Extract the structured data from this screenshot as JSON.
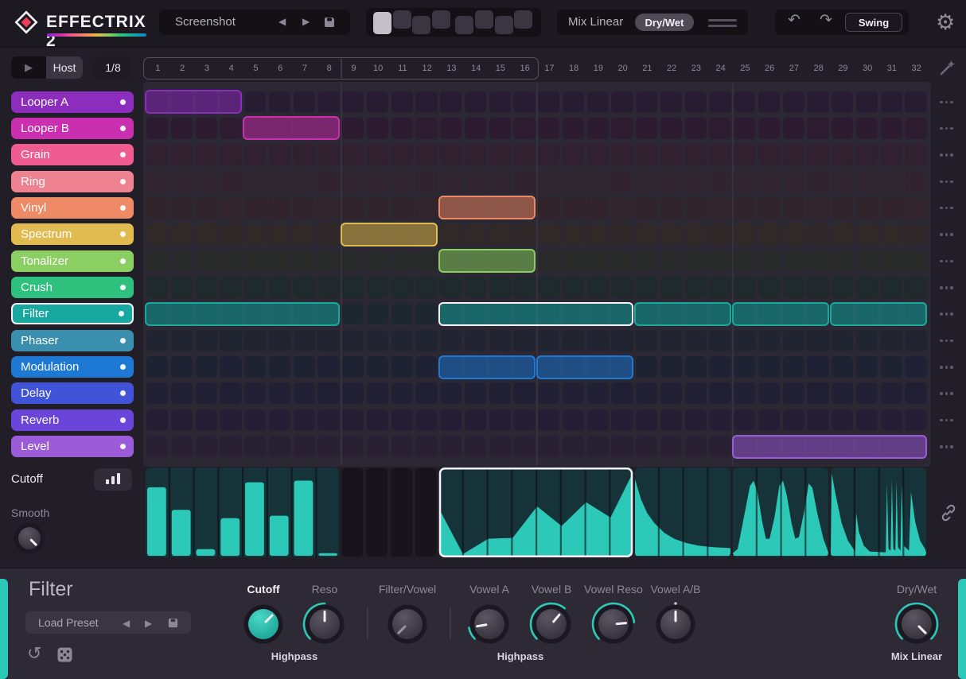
{
  "header": {
    "logo_text": "EFFECTRIX 2",
    "preset": {
      "name": "Screenshot"
    },
    "pattern_selector": {
      "count": 8,
      "selected": 1
    },
    "mix": {
      "label": "Mix Linear",
      "mode_button": "Dry/Wet"
    },
    "swing_button": "Swing"
  },
  "transport": {
    "host": "Host",
    "rate": "1/8"
  },
  "tracks": [
    {
      "name": "Looper A",
      "color": "#8c2dbd"
    },
    {
      "name": "Looper B",
      "color": "#c92fae"
    },
    {
      "name": "Grain",
      "color": "#f05c90"
    },
    {
      "name": "Ring",
      "color": "#ef8290"
    },
    {
      "name": "Vinyl",
      "color": "#ee8a66"
    },
    {
      "name": "Spectrum",
      "color": "#e2bb50"
    },
    {
      "name": "Tonalizer",
      "color": "#8bcf62"
    },
    {
      "name": "Crush",
      "color": "#2ec17e"
    },
    {
      "name": "Filter",
      "color": "#17a8a0",
      "selected": true
    },
    {
      "name": "Phaser",
      "color": "#3b8fae"
    },
    {
      "name": "Modulation",
      "color": "#1d79d4"
    },
    {
      "name": "Delay",
      "color": "#4153d8"
    },
    {
      "name": "Reverb",
      "color": "#6b45da"
    },
    {
      "name": "Level",
      "color": "#9c5bd9"
    }
  ],
  "grid": {
    "columns": 32,
    "loop_end": 16,
    "column_numbers": [
      1,
      2,
      3,
      4,
      5,
      6,
      7,
      8,
      9,
      10,
      11,
      12,
      13,
      14,
      15,
      16,
      17,
      18,
      19,
      20,
      21,
      22,
      23,
      24,
      25,
      26,
      27,
      28,
      29,
      30,
      31,
      32
    ]
  },
  "blocks": [
    {
      "track": 0,
      "start": 1,
      "end": 4
    },
    {
      "track": 1,
      "start": 5,
      "end": 8
    },
    {
      "track": 4,
      "start": 13,
      "end": 16
    },
    {
      "track": 5,
      "start": 9,
      "end": 12
    },
    {
      "track": 6,
      "start": 13,
      "end": 16
    },
    {
      "track": 8,
      "start": 1,
      "end": 8
    },
    {
      "track": 8,
      "start": 13,
      "end": 20,
      "selected": true
    },
    {
      "track": 8,
      "start": 21,
      "end": 24
    },
    {
      "track": 8,
      "start": 25,
      "end": 28
    },
    {
      "track": 8,
      "start": 29,
      "end": 32
    },
    {
      "track": 10,
      "start": 13,
      "end": 16
    },
    {
      "track": 10,
      "start": 17,
      "end": 20
    },
    {
      "track": 13,
      "start": 25,
      "end": 32
    }
  ],
  "automation": {
    "param_label": "Cutoff",
    "smooth_label": "Smooth",
    "smooth_value": 1.0,
    "lane_color": "#2dc9b8",
    "regions": [
      {
        "type": "bars",
        "start": 1,
        "end": 8,
        "values": [
          0.82,
          0.55,
          0.08,
          0.45,
          0.88,
          0.48,
          0.9,
          0.03
        ]
      },
      {
        "type": "empty",
        "start": 9,
        "end": 12
      },
      {
        "type": "polyline",
        "start": 13,
        "end": 20,
        "selected": true,
        "points": [
          [
            0,
            0.55
          ],
          [
            0.97,
            0.02
          ],
          [
            2,
            0.2
          ],
          [
            3,
            0.21
          ],
          [
            4,
            0.58
          ],
          [
            5,
            0.35
          ],
          [
            6,
            0.63
          ],
          [
            7,
            0.45
          ],
          [
            8,
            0.97
          ]
        ]
      },
      {
        "type": "polyline",
        "start": 21,
        "end": 24,
        "points": [
          [
            0,
            0.9
          ],
          [
            0.25,
            0.66
          ],
          [
            0.5,
            0.5
          ],
          [
            0.8,
            0.38
          ],
          [
            1.2,
            0.27
          ],
          [
            1.6,
            0.2
          ],
          [
            2.1,
            0.15
          ],
          [
            2.6,
            0.12
          ],
          [
            3.2,
            0.1
          ],
          [
            4,
            0.09
          ]
        ]
      },
      {
        "type": "polyline",
        "start": 25,
        "end": 28,
        "points": [
          [
            0,
            0.03
          ],
          [
            0.2,
            0.08
          ],
          [
            0.45,
            0.45
          ],
          [
            0.7,
            0.82
          ],
          [
            0.85,
            0.88
          ],
          [
            1,
            0.75
          ],
          [
            1.2,
            0.4
          ],
          [
            1.35,
            0.2
          ],
          [
            1.5,
            0.2
          ],
          [
            1.7,
            0.45
          ],
          [
            1.9,
            0.82
          ],
          [
            2.05,
            0.88
          ],
          [
            2.2,
            0.72
          ],
          [
            2.4,
            0.38
          ],
          [
            2.55,
            0.2
          ],
          [
            2.7,
            0.22
          ],
          [
            2.9,
            0.5
          ],
          [
            3.1,
            0.85
          ],
          [
            3.25,
            0.8
          ],
          [
            3.45,
            0.5
          ],
          [
            3.7,
            0.2
          ],
          [
            4,
            0.04
          ]
        ]
      },
      {
        "type": "polyline",
        "start": 29,
        "end": 32,
        "points": [
          [
            0,
            0.03
          ],
          [
            0.04,
            0.97
          ],
          [
            0.2,
            0.72
          ],
          [
            0.45,
            0.38
          ],
          [
            0.7,
            0.18
          ],
          [
            0.95,
            0.07
          ],
          [
            1.0,
            0.04
          ],
          [
            1.04,
            0.5
          ],
          [
            1.15,
            0.28
          ],
          [
            1.35,
            0.12
          ],
          [
            1.6,
            0.05
          ],
          [
            2.25,
            0.04
          ],
          [
            2.3,
            0.85
          ],
          [
            2.36,
            0.08
          ],
          [
            2.45,
            0.06
          ],
          [
            2.5,
            0.9
          ],
          [
            2.56,
            0.08
          ],
          [
            2.64,
            0.06
          ],
          [
            2.69,
            0.88
          ],
          [
            2.75,
            0.1
          ],
          [
            2.85,
            0.06
          ],
          [
            2.9,
            0.82
          ],
          [
            2.98,
            0.12
          ],
          [
            3.2,
            0.06
          ],
          [
            3.28,
            0.75
          ],
          [
            3.45,
            0.4
          ],
          [
            3.65,
            0.18
          ],
          [
            3.85,
            0.08
          ],
          [
            4,
            0.04
          ]
        ]
      }
    ]
  },
  "panel": {
    "title": "Filter",
    "load_preset": "Load Preset",
    "knobs": [
      {
        "label": "Cutoff",
        "value": 0.667,
        "show_arc": false,
        "filled": true,
        "bold": true
      },
      {
        "label": "Reso",
        "value": 0.5,
        "show_arc": true
      },
      {
        "label": "Filter/Vowel",
        "value": 0.0,
        "show_arc": false
      },
      {
        "label": "Vowel A",
        "value": 0.13,
        "show_arc": true
      },
      {
        "label": "Vowel B",
        "value": 0.648,
        "show_arc": true
      },
      {
        "label": "Vowel Reso",
        "value": 0.815,
        "show_arc": true
      },
      {
        "label": "Vowel A/B",
        "value": 0.5,
        "show_arc": false,
        "dot": true
      },
      {
        "label": "Dry/Wet",
        "value": 1.0,
        "show_arc": true
      }
    ],
    "sublabels": [
      "Highpass",
      "Highpass",
      "Mix Linear"
    ]
  }
}
